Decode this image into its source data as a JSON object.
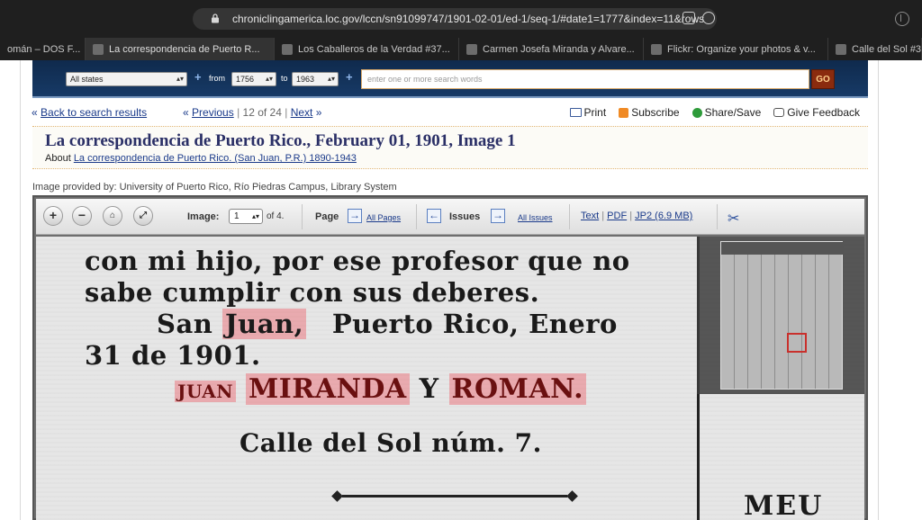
{
  "browser": {
    "url": "chroniclingamerica.loc.gov/lccn/sn91099747/1901-02-01/ed-1/seq-1/#date1=1777&index=11&rows",
    "tabs": [
      {
        "label": "omán – DOS F...",
        "active": false
      },
      {
        "label": "La correspondencia de Puerto R...",
        "active": true
      },
      {
        "label": "Los Caballeros de la Verdad #37...",
        "active": false
      },
      {
        "label": "Carmen Josefa Miranda y Alvare...",
        "active": false
      },
      {
        "label": "Flickr: Organize your photos & v...",
        "active": false
      },
      {
        "label": "Calle del Sol #3",
        "active": false
      }
    ]
  },
  "search": {
    "state": "All states",
    "from_label": "from",
    "from_year": "1756",
    "to_label": "to",
    "to_year": "1963",
    "placeholder": "enter one or more search words",
    "go_label": "GO"
  },
  "nav": {
    "back": "Back to search results",
    "previous": "Previous",
    "position": "12 of 24",
    "next": "Next",
    "print": "Print",
    "subscribe": "Subscribe",
    "share": "Share/Save",
    "feedback": "Give Feedback"
  },
  "page_title": "La correspondencia de Puerto Rico., February 01, 1901, Image 1",
  "about": {
    "prefix": "About",
    "link": "La correspondencia de Puerto Rico. (San Juan, P.R.) 1890-1943"
  },
  "provided_by": "Image provided by: University of Puerto Rico, Río Piedras Campus, Library System",
  "viewer": {
    "image_label": "Image:",
    "image_value": "1",
    "image_of": "of 4.",
    "page_label": "Page",
    "all_pages": "All Pages",
    "issues_label": "Issues",
    "all_issues": "All Issues",
    "text_link": "Text",
    "pdf_link": "PDF",
    "jp2_link": "JP2 (6.9 MB)"
  },
  "scan_text": {
    "line1": "con mi hijo, por ese profesor que no",
    "line2": "sabe cumplir con sus deberes.",
    "line3_a": "San",
    "line3_b": "Juan,",
    "line3_c": "Puerto Rico, Enero",
    "line4": "31 de 1901.",
    "line5_a": "JUAN",
    "line5_b": "MIRANDA",
    "line5_c": "Y",
    "line5_d": "ROMAN.",
    "line6": "Calle del Sol núm. 7.",
    "fragment": "MEU"
  },
  "colors": {
    "accent_blue": "#2a2f66",
    "highlight": "#eb7882",
    "searchbar": "#173a66",
    "go_button": "#8a2b0e"
  }
}
